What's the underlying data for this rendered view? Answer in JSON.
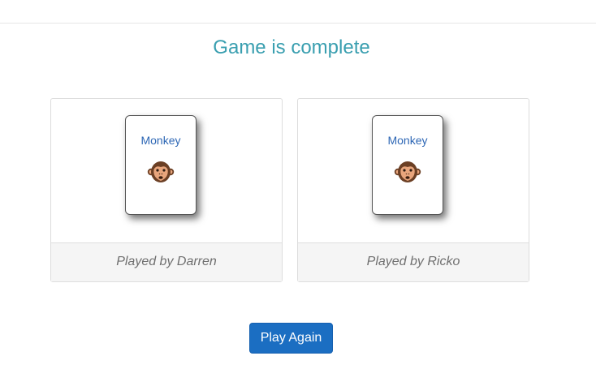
{
  "header": {
    "title": "Game is complete"
  },
  "players": [
    {
      "card_label": "Monkey",
      "card_icon": "monkey-face-icon",
      "footer": "Played by Darren"
    },
    {
      "card_label": "Monkey",
      "card_icon": "monkey-face-icon",
      "footer": "Played by Ricko"
    }
  ],
  "actions": {
    "play_again_label": "Play Again"
  },
  "colors": {
    "title": "#3a9fb0",
    "card_label": "#2e67b5",
    "button_bg": "#1b6ec2",
    "footer_bg": "#f5f5f5"
  }
}
